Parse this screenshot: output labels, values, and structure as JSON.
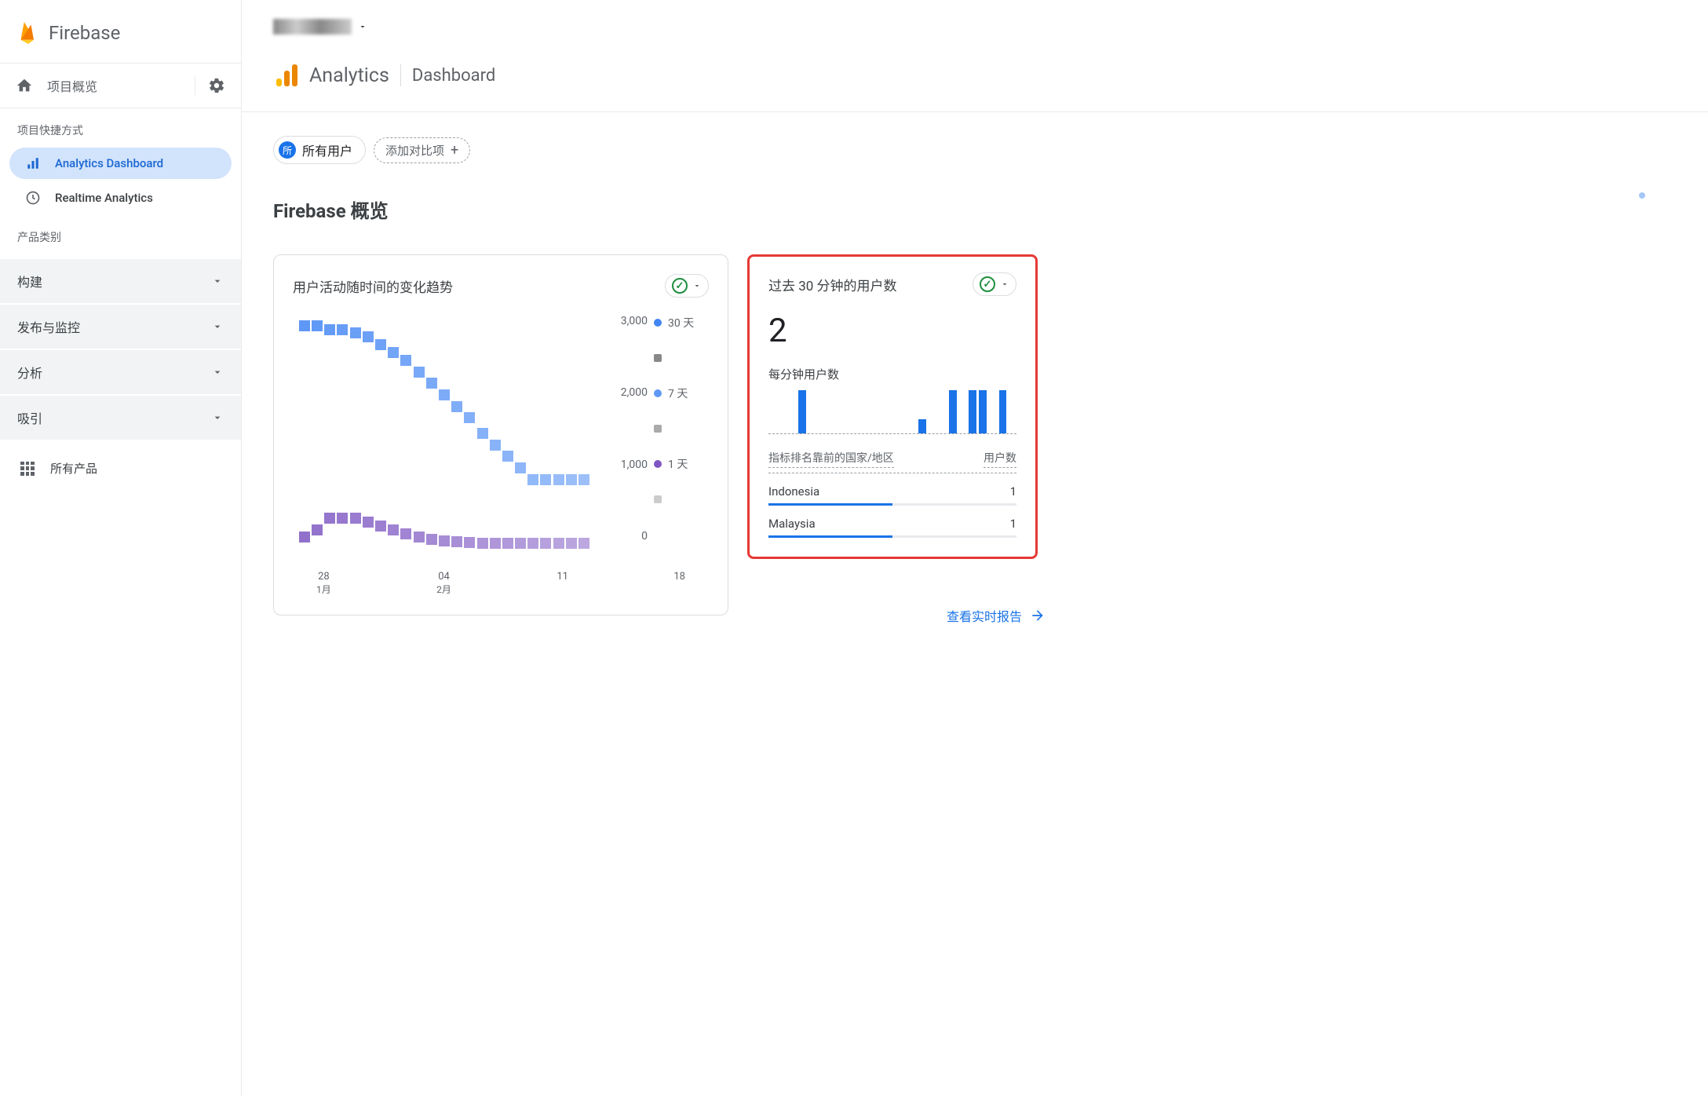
{
  "brand": "Firebase",
  "sidebar": {
    "project_overview": "项目概览",
    "shortcuts_label": "项目快捷方式",
    "nav_items": [
      {
        "label": "Analytics Dashboard",
        "active": true
      },
      {
        "label": "Realtime Analytics",
        "active": false
      }
    ],
    "categories_label": "产品类别",
    "categories": [
      {
        "label": "构建"
      },
      {
        "label": "发布与监控"
      },
      {
        "label": "分析"
      },
      {
        "label": "吸引"
      }
    ],
    "all_products": "所有产品"
  },
  "header": {
    "analytics_title": "Analytics",
    "dashboard_title": "Dashboard"
  },
  "filters": {
    "all_badge": "所",
    "all_users": "所有用户",
    "add_compare": "添加对比项"
  },
  "overview_title": "Firebase 概览",
  "trend_card": {
    "title": "用户活动随时间的变化趋势",
    "legend": [
      {
        "label": "30 天",
        "color": "#4285f4"
      },
      {
        "label": "7 天",
        "color": "#5e97f6"
      },
      {
        "label": "1 天",
        "color": "#7e57c2"
      }
    ],
    "legend_square": "#888",
    "xaxis": [
      {
        "tick": "28",
        "sub": "1月"
      },
      {
        "tick": "04",
        "sub": "2月"
      },
      {
        "tick": "11",
        "sub": ""
      },
      {
        "tick": "18",
        "sub": ""
      }
    ]
  },
  "chart_data": {
    "type": "scatter",
    "title": "用户活动随时间的变化趋势",
    "ylabel": "",
    "ylim": [
      0,
      3000
    ],
    "yticks": [
      0,
      1000,
      2000,
      3000
    ],
    "x_dates": [
      "1月26",
      "1月27",
      "1月28",
      "1月29",
      "1月30",
      "1月31",
      "2月01",
      "2月02",
      "2月03",
      "2月04",
      "2月05",
      "2月06",
      "2月07",
      "2月08",
      "2月09",
      "2月10",
      "2月11",
      "2月12",
      "2月13",
      "2月14",
      "2月15",
      "2月16",
      "2月17",
      "2月18"
    ],
    "series": [
      {
        "name": "30 天",
        "color": "#4285f4",
        "values": [
          2900,
          2900,
          2850,
          2850,
          2800,
          2750,
          2650,
          2550,
          2450,
          2300,
          2150,
          2000,
          1850,
          1700,
          1500,
          1350,
          1200,
          1050,
          900,
          900,
          900,
          900,
          900,
          null
        ]
      },
      {
        "name": "7 天",
        "color": "#8ab4f8",
        "values": [
          null,
          null,
          null,
          null,
          null,
          null,
          null,
          null,
          null,
          null,
          null,
          null,
          null,
          null,
          null,
          null,
          null,
          null,
          null,
          null,
          null,
          null,
          null,
          null
        ]
      },
      {
        "name": "1 天",
        "color": "#7e57c2",
        "values": [
          150,
          250,
          400,
          400,
          400,
          350,
          300,
          250,
          200,
          150,
          120,
          100,
          90,
          80,
          70,
          70,
          70,
          70,
          70,
          70,
          70,
          70,
          70,
          null
        ]
      }
    ]
  },
  "realtime_card": {
    "title": "过去 30 分钟的用户数",
    "value": "2",
    "per_minute_label": "每分钟用户数",
    "minibar_values": [
      0,
      0,
      0,
      3,
      0,
      0,
      0,
      0,
      0,
      0,
      0,
      0,
      0,
      0,
      0,
      1,
      0,
      0,
      3,
      0,
      3,
      3,
      0,
      3,
      0
    ],
    "country_header_left": "指标排名靠前的国家/地区",
    "country_header_right": "用户数",
    "countries": [
      {
        "name": "Indonesia",
        "count": "1",
        "pct": 50
      },
      {
        "name": "Malaysia",
        "count": "1",
        "pct": 50
      }
    ],
    "view_link": "查看实时报告"
  }
}
